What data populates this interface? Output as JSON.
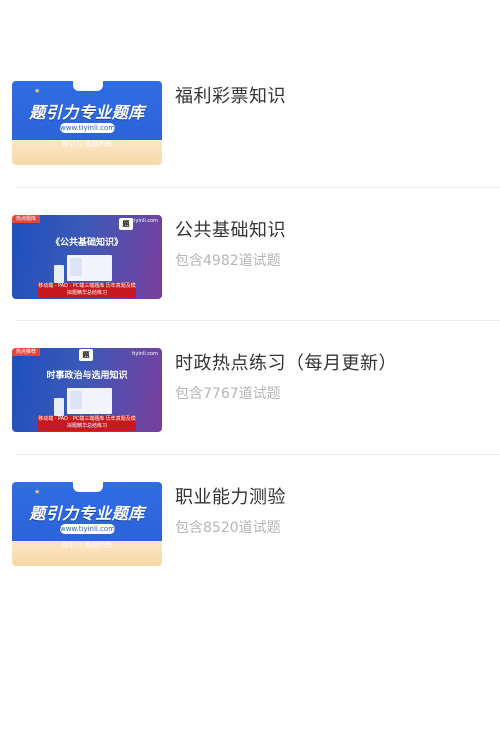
{
  "list": [
    {
      "title": "福利彩票知识",
      "count": "",
      "thumb": {
        "style": "blue",
        "headline": "题引力专业题库",
        "url": "www.tiyinli.com",
        "sub": "题引力 悉数所有"
      }
    },
    {
      "title": "公共基础知识",
      "count": "包含4982道试题",
      "thumb": {
        "style": "purple",
        "tag": "热点题库",
        "site": "tiyinli.com",
        "heading": "《公共基础知识》",
        "banner": "移动端 · PAD · PC端三端题库 历年真题及模拟题精华总结练习"
      }
    },
    {
      "title": "时政热点练习（每月更新）",
      "count": "包含7767道试题",
      "thumb": {
        "style": "purple",
        "tag": "热点推荐",
        "site": "tiyinli.com",
        "heading": "时事政治与选用知识",
        "banner": "移动端 · PAD · PC端三端题库 历年真题及模拟题精华总结练习"
      }
    },
    {
      "title": "职业能力测验",
      "count": "包含8520道试题",
      "thumb": {
        "style": "blue",
        "headline": "题引力专业题库",
        "url": "www.tiyinli.com",
        "sub": "题引力 悉数所有"
      }
    }
  ]
}
